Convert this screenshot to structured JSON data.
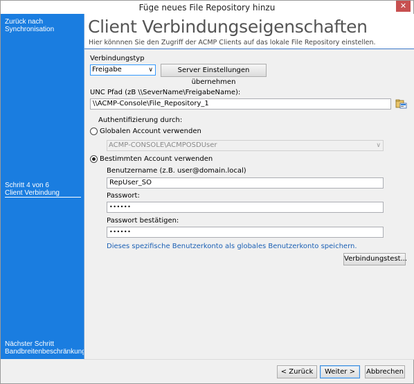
{
  "window": {
    "title": "Füge neues File Repository hinzu",
    "close_glyph": "✕"
  },
  "sidebar": {
    "back_line1": "Zurück nach",
    "back_line2": "Synchronisation",
    "step_line1": "Schritt 4 von 6",
    "step_line2": "Client Verbindung",
    "next_line1": "Nächster Schritt",
    "next_line2": "Bandbreitenbeschränkung"
  },
  "header": {
    "title": "Client Verbindungseigenschaften",
    "subtitle": "Hier könnnen Sie den Zugriff der ACMP Clients auf das lokale File Repository einstellen."
  },
  "form": {
    "connection_type_label": "Verbindungstyp",
    "connection_type_value": "Freigabe",
    "apply_server_settings_button": "Server Einstellungen übernehmen",
    "unc_label": "UNC Pfad (zB \\\\SeverName\\FreigabeName):",
    "unc_value": "\\\\ACMP-Console\\File_Repository_1",
    "auth_label": "Authentifizierung durch:",
    "global_account_label": "Globalen Account verwenden",
    "global_account_selected": false,
    "global_account_value": "ACMP-CONSOLE\\ACMPOSDUser",
    "specific_account_label": "Bestimmten Account verwenden",
    "specific_account_selected": true,
    "username_label": "Benutzername (z.B. user@domain.local)",
    "username_value": "RepUser_SO",
    "password_label": "Passwort:",
    "password_value": "••••••",
    "password_confirm_label": "Passwort bestätigen:",
    "password_confirm_value": "••••••",
    "save_global_link": "Dieses spezifische Benutzerkonto als globales Benutzerkonto speichern.",
    "connection_test_button": "Verbindungstest..."
  },
  "footer": {
    "back_button": "< Zurück",
    "next_button": "Weiter >",
    "cancel_button": "Abbrechen"
  },
  "icons": {
    "dropdown": "chevron-down-icon",
    "browse": "folder-browse-icon",
    "close": "close-icon"
  },
  "colors": {
    "sidebar_bg": "#1a7de0",
    "link": "#1a5fb4",
    "close_bg": "#c75050"
  }
}
